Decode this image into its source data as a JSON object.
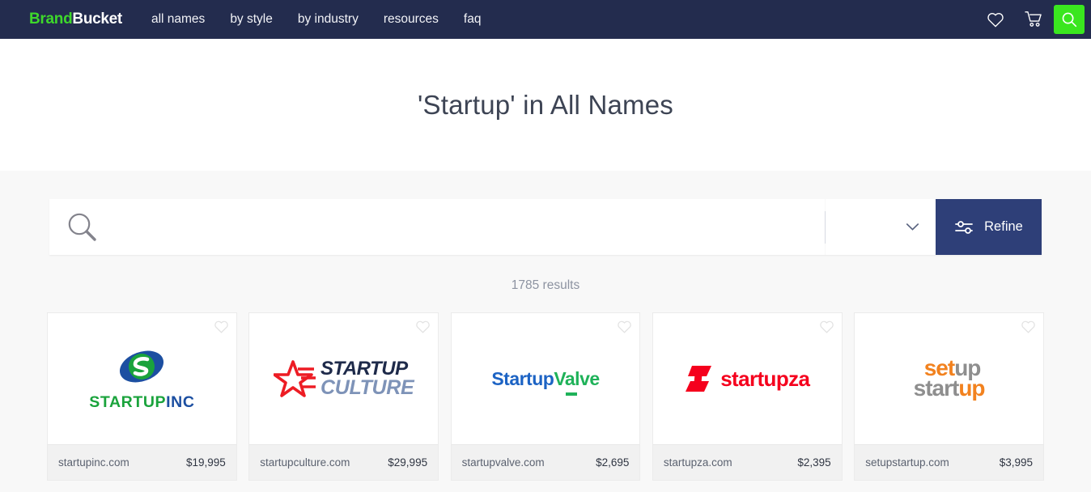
{
  "navbar": {
    "brand_part1": "Brand",
    "brand_part2": "Bucket",
    "links": [
      {
        "label": "all names"
      },
      {
        "label": "by style"
      },
      {
        "label": "by industry"
      },
      {
        "label": "resources"
      },
      {
        "label": "faq"
      }
    ],
    "icons": {
      "wishlist": "heart-icon",
      "cart": "cart-icon",
      "search": "search-icon"
    },
    "colors": {
      "background": "#232c4e",
      "brand_accent": "#3ed82b",
      "search_button": "#3ae61f"
    }
  },
  "hero": {
    "title": "'Startup' in All Names"
  },
  "search": {
    "value": "",
    "placeholder": "",
    "filter_selected": "",
    "refine_label": "Refine",
    "refine_color": "#2e3f78"
  },
  "results": {
    "count_text": "1785 results"
  },
  "cards": [
    {
      "domain": "startupinc.com",
      "price": "$19,995",
      "logo": {
        "part1": "STARTUP",
        "part2": "INC",
        "color1": "#1aa33c",
        "color2": "#1c4fa1"
      }
    },
    {
      "domain": "startupculture.com",
      "price": "$29,995",
      "logo": {
        "part1": "STARTUP",
        "part2": "CULTURE",
        "color1": "#1e2a4a",
        "color2": "#7e93b8"
      }
    },
    {
      "domain": "startupvalve.com",
      "price": "$2,695",
      "logo": {
        "part1": "Startup",
        "part2": "Valve",
        "color1": "#1c63c4",
        "color2": "#1fb259"
      }
    },
    {
      "domain": "startupza.com",
      "price": "$2,395",
      "logo": {
        "part1": "startupza",
        "part2": "",
        "color1": "#f5001d",
        "color2": "#f5001d"
      }
    },
    {
      "domain": "setupstartup.com",
      "price": "$3,995",
      "logo": {
        "part1": "set",
        "part2": "up",
        "part3": "start",
        "part4": "up",
        "color1": "#f2821f",
        "color2": "#8e8e8e"
      }
    }
  ]
}
